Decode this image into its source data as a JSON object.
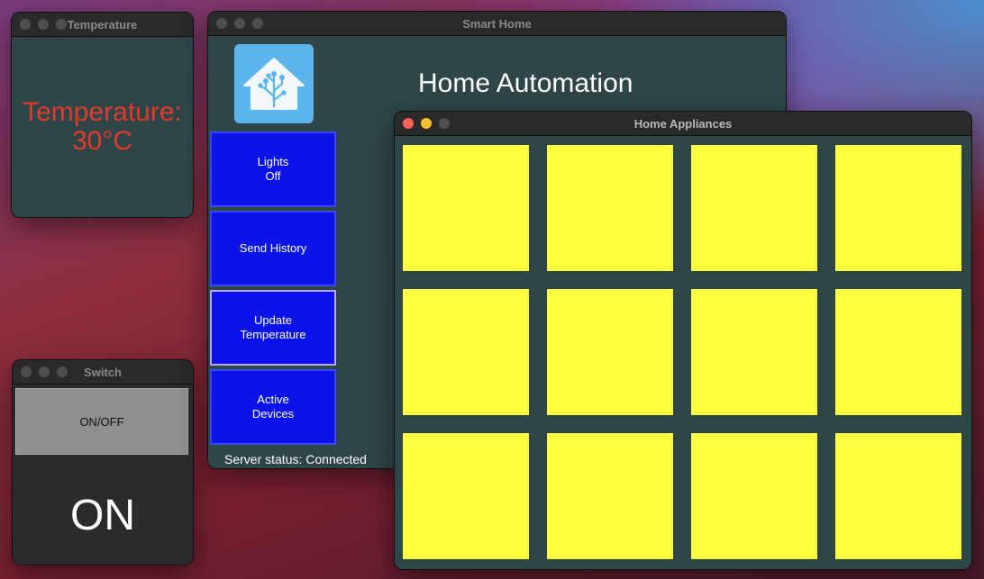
{
  "windows": {
    "temperature": {
      "title": "Temperature",
      "reading": "Temperature:\n30°C"
    },
    "switch": {
      "title": "Switch",
      "button_label": "ON/OFF",
      "state": "ON"
    },
    "smart_home": {
      "title": "Smart Home",
      "heading": "Home Automation",
      "logo_icon": "home-assistant-icon",
      "buttons": [
        {
          "label": "Lights\nOff"
        },
        {
          "label": "Send History"
        },
        {
          "label": "Update\nTemperature"
        },
        {
          "label": "Active\nDevices"
        }
      ],
      "server_status": "Server status: Connected"
    },
    "appliances": {
      "title": "Home Appliances",
      "tile_color": "#ffff40",
      "tile_count": 12
    }
  },
  "colors": {
    "temperature_text": "#e03a2a",
    "button_blue": "#0c13e8",
    "panel_bg": "#2f4648",
    "logo_bg": "#5bb5ec"
  }
}
